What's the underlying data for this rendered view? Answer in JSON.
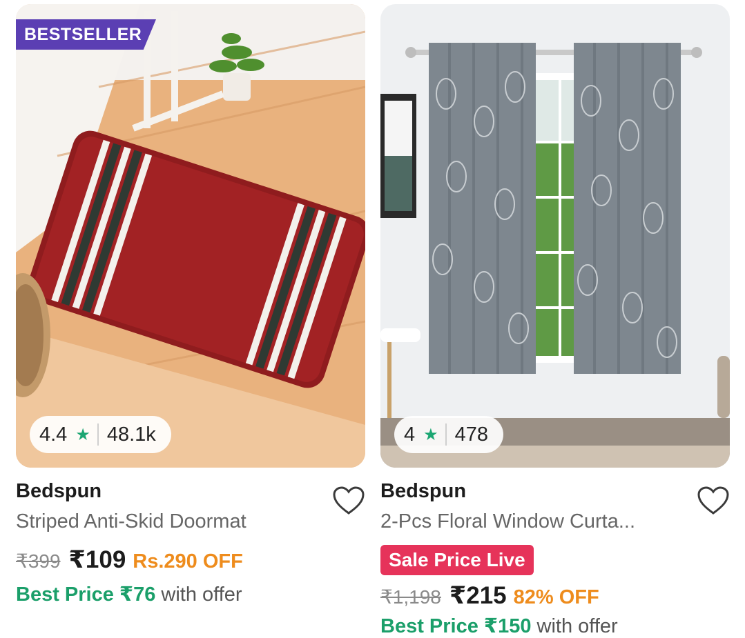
{
  "products": [
    {
      "badge": "BESTSELLER",
      "rating": "4.4",
      "star_icon": "star-icon",
      "rating_count": "48.1k",
      "brand": "Bedspun",
      "title": "Striped Anti-Skid Doormat",
      "mrp": "₹399",
      "price": "₹109",
      "discount": "Rs.290 OFF",
      "best_price_label": "Best Price ₹76",
      "best_price_suffix": " with offer",
      "wishlist_icon": "heart-outline-icon"
    },
    {
      "sale_tag": "Sale Price Live",
      "rating": "4",
      "star_icon": "star-icon",
      "rating_count": "478",
      "brand": "Bedspun",
      "title": "2-Pcs Floral Window Curta...",
      "mrp": "₹1,198",
      "price": "₹215",
      "discount": "82% OFF",
      "best_price_label": "Best Price ₹150",
      "best_price_suffix": " with offer",
      "wishlist_icon": "heart-outline-icon"
    }
  ],
  "colors": {
    "badge": "#5b3fb3",
    "star": "#1ba672",
    "discount": "#ee8c1d",
    "best_price": "#1b9f6a",
    "sale_tag": "#e6335a"
  }
}
